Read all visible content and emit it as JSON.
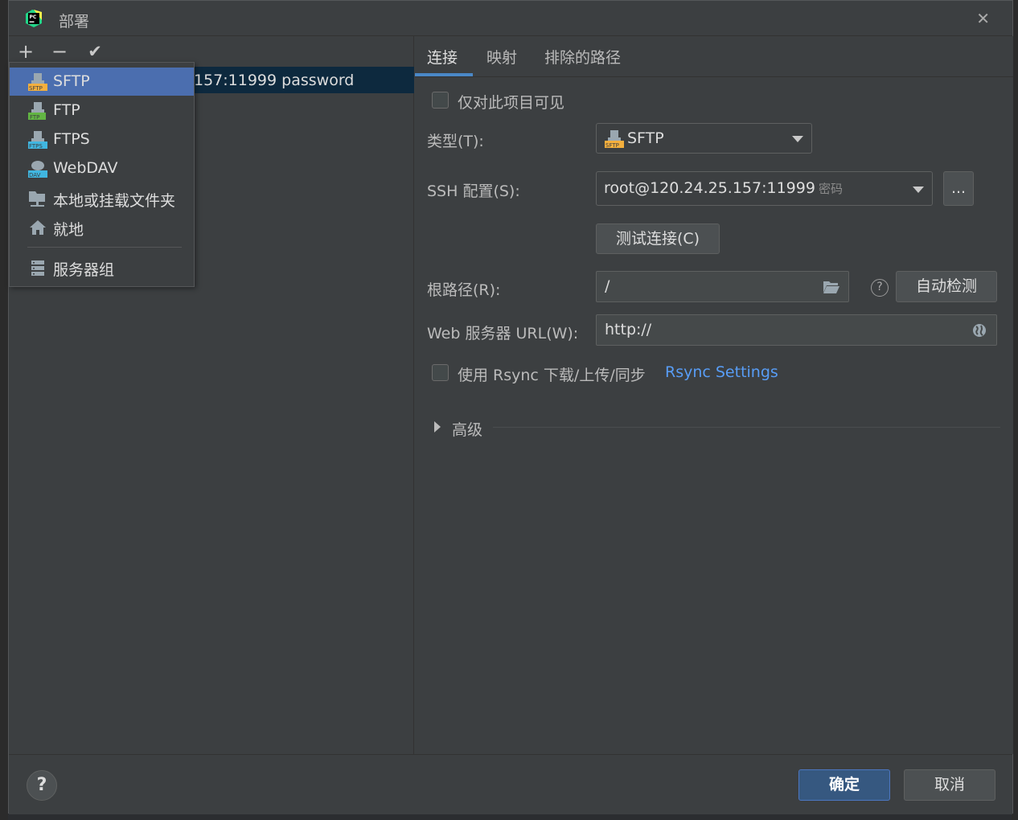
{
  "window": {
    "title": "部署"
  },
  "toolbar": {
    "add": "+",
    "remove": "−",
    "apply": "✔"
  },
  "server_list": {
    "row_text": "157:11999 password"
  },
  "add_menu": {
    "items": [
      {
        "label": "SFTP",
        "icon": "sftp-icon",
        "selected": true
      },
      {
        "label": "FTP",
        "icon": "ftp-icon"
      },
      {
        "label": "FTPS",
        "icon": "ftps-icon"
      },
      {
        "label": "WebDAV",
        "icon": "webdav-icon"
      },
      {
        "label": "本地或挂载文件夹",
        "icon": "folder-icon"
      },
      {
        "label": "就地",
        "icon": "home-icon"
      },
      {
        "label": "服务器组",
        "icon": "server-group-icon"
      }
    ]
  },
  "tabs": [
    {
      "label": "连接",
      "active": true
    },
    {
      "label": "映射"
    },
    {
      "label": "排除的路径"
    }
  ],
  "connection": {
    "visible_only_label": "仅对此项目可见",
    "type_label": "类型(T):",
    "type_value": "SFTP",
    "ssh_label": "SSH 配置(S):",
    "ssh_value": "root@120.24.25.157:11999",
    "ssh_hint": "密码",
    "ssh_more": "...",
    "test_button": "测试连接(C)",
    "root_label": "根路径(R):",
    "root_value": "/",
    "autodetect_button": "自动检测",
    "web_url_label": "Web 服务器 URL(W):",
    "web_url_value": "http://",
    "rsync_label": "使用 Rsync 下载/上传/同步",
    "rsync_link": "Rsync Settings",
    "advanced_label": "高级"
  },
  "footer": {
    "help": "?",
    "ok": "确定",
    "cancel": "取消"
  },
  "colors": {
    "accent": "#4b6eaf",
    "link": "#589df6",
    "ok_button": "#365880"
  }
}
